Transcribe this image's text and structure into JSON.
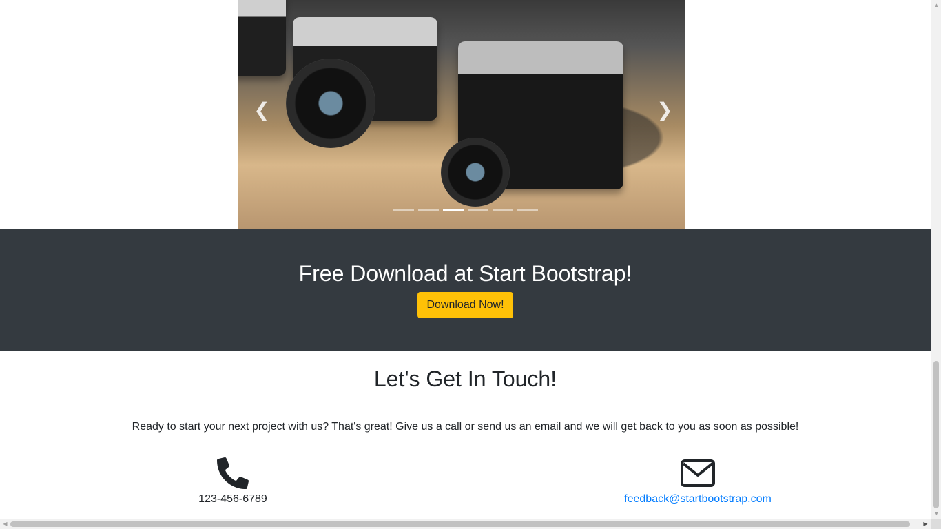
{
  "carousel": {
    "prev_icon": "chevron-left-icon",
    "next_icon": "chevron-right-icon",
    "prev_glyph": "❮",
    "next_glyph": "❯",
    "indicator_count": 6,
    "active_index": 2
  },
  "download": {
    "heading": "Free Download at Start Bootstrap!",
    "button_label": "Download Now!",
    "band_color": "#343a40",
    "button_color": "#ffc107"
  },
  "contact": {
    "heading": "Let's Get In Touch!",
    "lead": "Ready to start your next project with us? That's great! Give us a call or send us an email and we will get back to you as soon as possible!",
    "phone_icon": "phone-icon",
    "phone": "123-456-6789",
    "email_icon": "envelope-icon",
    "email": "feedback@startbootstrap.com",
    "link_color": "#007bff"
  },
  "scrollbars": {
    "vertical_icon_up": "arrow-up-icon",
    "vertical_icon_down": "arrow-down-icon",
    "horizontal_icon_left": "arrow-left-icon",
    "horizontal_icon_right": "arrow-right-icon",
    "up_glyph": "▲",
    "down_glyph": "▼",
    "left_glyph": "◀",
    "right_glyph": "▶"
  }
}
